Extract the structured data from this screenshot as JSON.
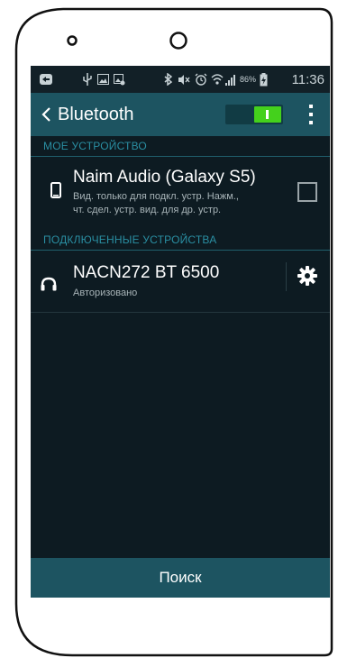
{
  "status_bar": {
    "time": "11:36",
    "battery_percent": "86%",
    "icons": [
      "messenger-icon",
      "usb-icon",
      "image-icon",
      "photo-icon",
      "bluetooth-icon",
      "mute-icon",
      "alarm-icon",
      "wifi-icon",
      "signal-icon",
      "battery-charging-icon"
    ]
  },
  "action_bar": {
    "title": "Bluetooth",
    "toggle_on": true,
    "colors": {
      "bar": "#1d5461",
      "toggle_on": "#44d11c"
    }
  },
  "sections": {
    "my_device_header": "МОЕ УСТРОЙСТВО",
    "connected_header": "ПОДКЛЮЧЕННЫЕ УСТРОЙСТВА"
  },
  "my_device": {
    "name": "Naim Audio (Galaxy S5)",
    "description_line1": "Вид. только для подкл. устр. Нажм.,",
    "description_line2": "чт. сдел. устр. вид. для др. устр.",
    "visible_checked": false
  },
  "connected_devices": [
    {
      "name": "NACN272 BT 6500",
      "status": "Авторизовано",
      "icon": "headphones-icon"
    }
  ],
  "footer": {
    "search_label": "Поиск"
  }
}
